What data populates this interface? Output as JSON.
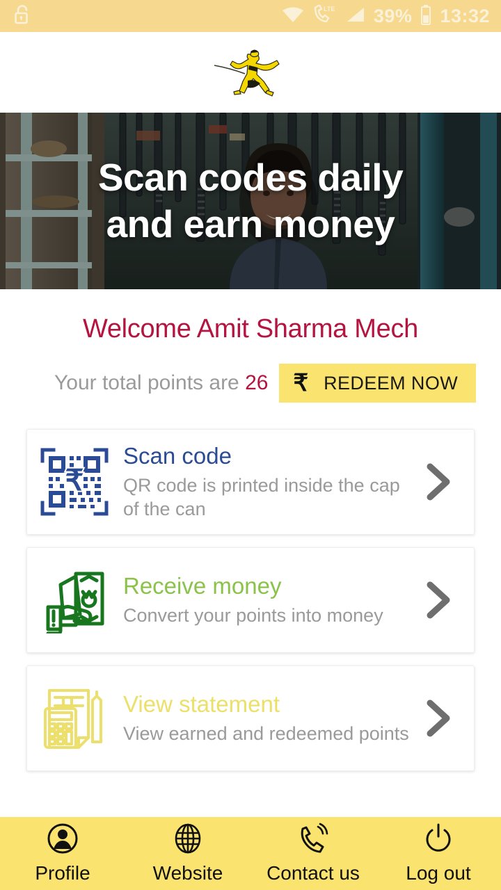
{
  "statusbar": {
    "lock_icon": "unlock-icon",
    "wifi_icon": "wifi-icon",
    "lte_icon": "lte-call-icon",
    "signal_icon": "signal-bars-icon",
    "battery_percent": "39%",
    "battery_icon": "battery-icon",
    "time": "13:32",
    "bg_color": "#f6d98f",
    "text_color": "#fbf0d8"
  },
  "header": {
    "logo_icon": "martial-artist-logo",
    "logo_color": "#f5d700"
  },
  "hero": {
    "title_line1": "Scan codes daily",
    "title_line2": "and earn money",
    "image_alt": "mechanic-in-workshop"
  },
  "welcome": {
    "text": "Welcome Amit Sharma Mech",
    "color": "#b4143f"
  },
  "points": {
    "label": "Your total points are",
    "value": "26",
    "redeem_rupee": "₹",
    "redeem_label": "REDEEM NOW",
    "redeem_bg": "#fae36e"
  },
  "cards": [
    {
      "icon": "qr-code-rupee-icon",
      "title": "Scan code",
      "subtitle": "QR code is printed inside the cap of the can",
      "title_color": "#2b4c94",
      "chevron": "chevron-right-icon"
    },
    {
      "icon": "hand-holding-money-icon",
      "title": "Receive money",
      "subtitle": "Convert your points into money",
      "title_color": "#8bc34a",
      "chevron": "chevron-right-icon"
    },
    {
      "icon": "calculator-statement-icon",
      "title": "View statement",
      "subtitle": "View earned and redeemed points",
      "title_color": "#ebe06a",
      "chevron": "chevron-right-icon"
    }
  ],
  "bottomnav": {
    "bg_color": "#fae36e",
    "items": [
      {
        "label": "Profile",
        "icon": "person-icon"
      },
      {
        "label": "Website",
        "icon": "globe-icon"
      },
      {
        "label": "Contact us",
        "icon": "phone-ring-icon"
      },
      {
        "label": "Log out",
        "icon": "power-icon"
      }
    ]
  }
}
